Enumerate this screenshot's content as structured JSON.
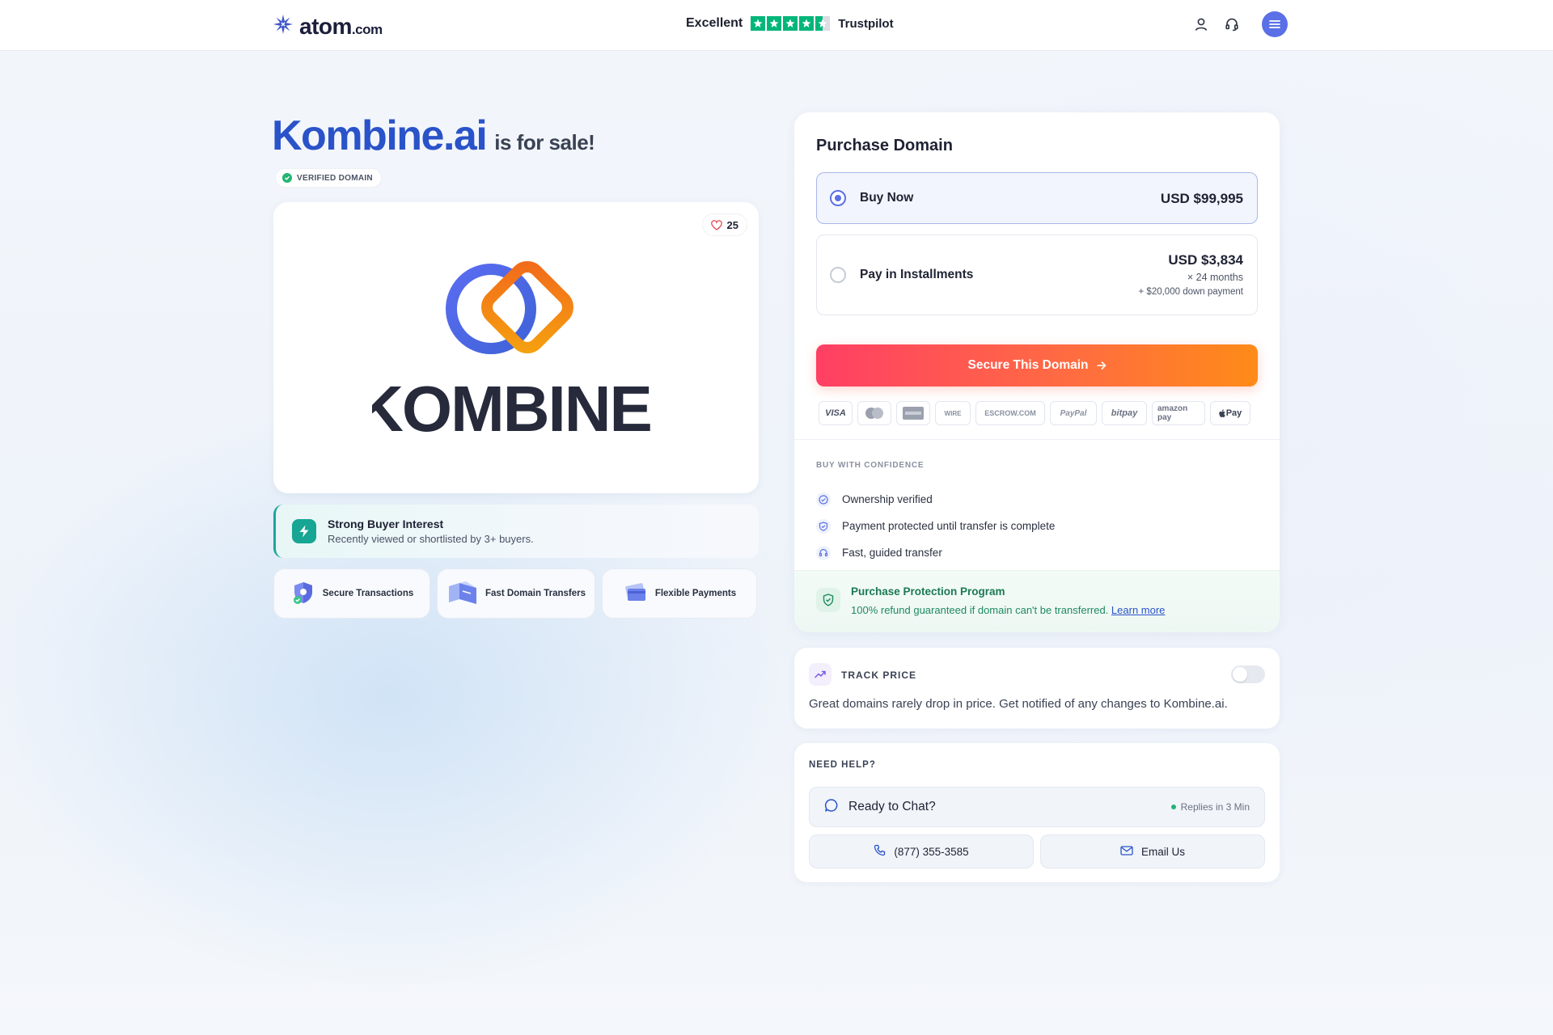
{
  "header": {
    "logo_main": "atom",
    "logo_suffix": ".com",
    "trust_label": "Excellent",
    "trust_brand": "Trustpilot",
    "trust_rating": 4.5,
    "trust_color": "#00b67a"
  },
  "domain": {
    "name": "Kombine.ai",
    "for_sale": "is for sale!",
    "verified_badge": "VERIFIED DOMAIN",
    "likes": "25",
    "logo_wordmark": "KOMBINE"
  },
  "interest": {
    "title": "Strong Buyer Interest",
    "subtitle": "Recently viewed or shortlisted by 3+ buyers."
  },
  "features": [
    {
      "label": "Secure Transactions",
      "icon": "shield-icon"
    },
    {
      "label": "Fast Domain Transfers",
      "icon": "transfer-icon"
    },
    {
      "label": "Flexible Payments",
      "icon": "wallet-icon"
    }
  ],
  "purchase": {
    "title": "Purchase Domain",
    "buy_now": {
      "label": "Buy Now",
      "price": "USD $99,995"
    },
    "installments": {
      "label": "Pay in Installments",
      "price": "USD $3,834",
      "term": "× 24 months",
      "down_payment": "+ $20,000 down payment"
    },
    "cta": "Secure This Domain",
    "payment_methods": [
      "VISA",
      "Mastercard",
      "Amex",
      "WIRE",
      "ESCROW.COM",
      "PayPal",
      "bitpay",
      "amazon pay",
      "Pay"
    ],
    "confidence_heading": "BUY WITH CONFIDENCE",
    "confidence_items": [
      "Ownership verified",
      "Payment protected until transfer is complete",
      "Fast, guided transfer"
    ],
    "protection_title": "Purchase Protection Program",
    "protection_text": "100% refund guaranteed if domain can't be transferred.",
    "protection_link": "Learn more"
  },
  "track": {
    "title": "TRACK PRICE",
    "text": "Great domains rarely drop in price. Get notified of any changes to Kombine.ai.",
    "enabled": false
  },
  "help": {
    "title": "NEED HELP?",
    "chat_label": "Ready to Chat?",
    "chat_status": "Replies in 3 Min",
    "phone": "(877) 355-3585",
    "email_label": "Email Us"
  },
  "colors": {
    "accent": "#5b6fe6",
    "brand_blue": "#2a53c9",
    "cta_start": "#ff3f64",
    "cta_end": "#ff8b18",
    "success": "#22b573"
  }
}
